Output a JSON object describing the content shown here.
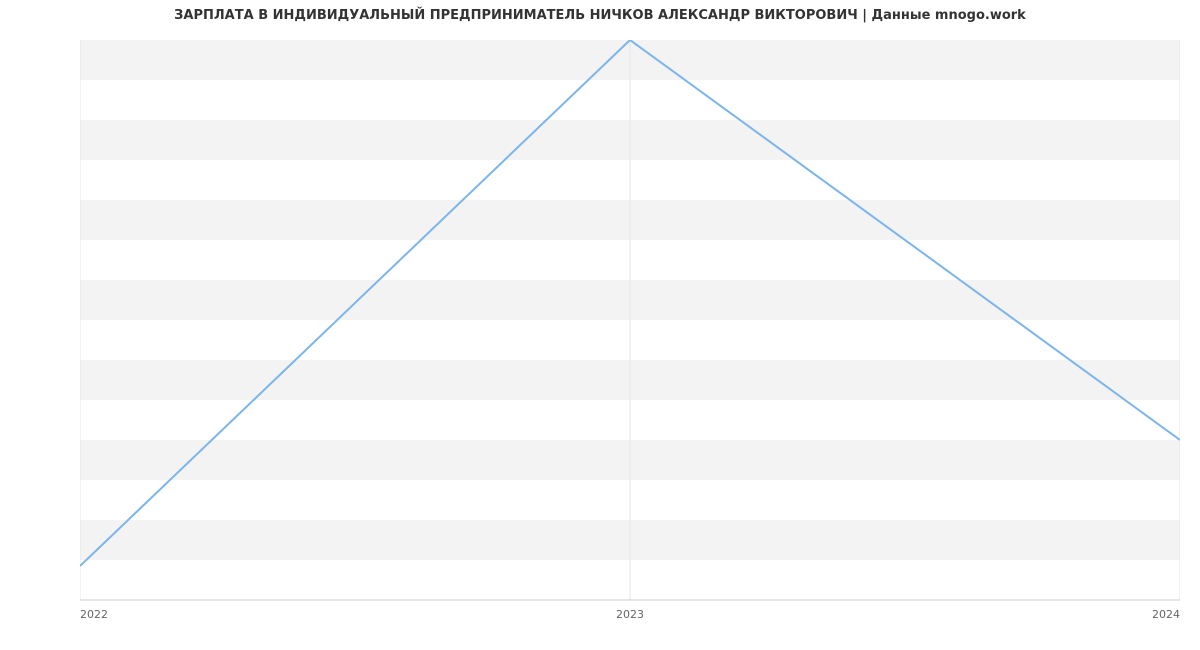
{
  "chart_data": {
    "type": "line",
    "title": "ЗАРПЛАТА В ИНДИВИДУАЛЬНЫЙ ПРЕДПРИНИМАТЕЛЬ НИЧКОВ АЛЕКСАНДР ВИКТОРОВИЧ | Данные mnogo.work",
    "x": [
      2022,
      2023,
      2024
    ],
    "values": [
      23700,
      50000,
      30000
    ],
    "xlabel": "",
    "ylabel": "",
    "xlim": [
      2022,
      2024
    ],
    "ylim": [
      22000,
      50000
    ],
    "y_ticks": [
      22000,
      24000,
      26000,
      28000,
      30000,
      32000,
      34000,
      36000,
      38000,
      40000,
      42000,
      44000,
      46000,
      48000,
      50000
    ],
    "x_ticks": [
      2022,
      2023,
      2024
    ]
  }
}
